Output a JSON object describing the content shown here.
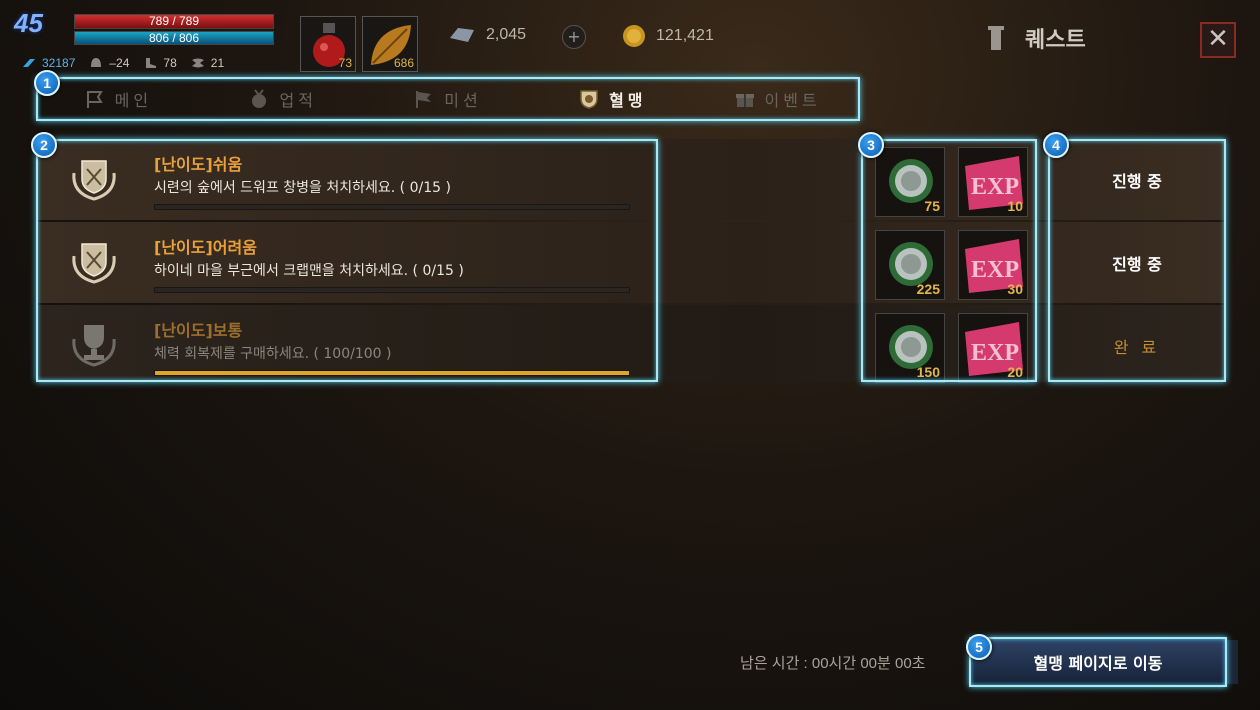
{
  "player": {
    "level": "45",
    "hp": "789 / 789",
    "mp": "806 / 806",
    "stats": [
      {
        "icon": "power-icon",
        "value": "32187"
      },
      {
        "icon": "helmet-icon",
        "value": "–24"
      },
      {
        "icon": "boot-icon",
        "value": "78"
      },
      {
        "icon": "wing-icon",
        "value": "21"
      }
    ]
  },
  "inventory": [
    {
      "icon": "red-potion-icon",
      "count": "73"
    },
    {
      "icon": "leaf-icon",
      "count": "686"
    }
  ],
  "currency": {
    "diamond": "2,045",
    "plus": "+",
    "gold": "121,421"
  },
  "window": {
    "title": "퀘스트",
    "close": "✕"
  },
  "tabs": [
    {
      "label": "메인",
      "icon": "flag-icon",
      "active": false
    },
    {
      "label": "업적",
      "icon": "medal-icon",
      "active": false
    },
    {
      "label": "미션",
      "icon": "mission-flag-icon",
      "active": false
    },
    {
      "label": "혈맹",
      "icon": "clan-shield-icon",
      "active": true
    },
    {
      "label": "이벤트",
      "icon": "gift-icon",
      "active": false
    }
  ],
  "quests": [
    {
      "title": "[난이도]쉬움",
      "desc": "시련의 숲에서 드워프 창병을 처치하세요. ( 0/15 )",
      "progress": 0,
      "emblem": "laurel-crest-icon",
      "reward_coin": "75",
      "reward_exp": "10",
      "status": "진행 중"
    },
    {
      "title": "[난이도]어려움",
      "desc": "하이네 마을 부근에서 크랩맨을 처치하세요. ( 0/15 )",
      "progress": 0,
      "emblem": "laurel-crest-icon",
      "reward_coin": "225",
      "reward_exp": "30",
      "status": "진행 중"
    },
    {
      "title": "[난이도]보통",
      "desc": "체력 회복제를 구매하세요. ( 100/100 )",
      "progress": 1.0,
      "emblem": "trophy-icon",
      "reward_coin": "150",
      "reward_exp": "20",
      "status": "완 료"
    }
  ],
  "markers": [
    "1",
    "2",
    "3",
    "4",
    "5"
  ],
  "footer": {
    "remaining": "남은 시간 : 00시간 00분 00초",
    "goto_button": "혈맹 페이지로 이동"
  },
  "colors": {
    "accent_gold": "#e9a13a",
    "frame_highlight": "#aee6f4",
    "button_blue": "#2f4467"
  }
}
